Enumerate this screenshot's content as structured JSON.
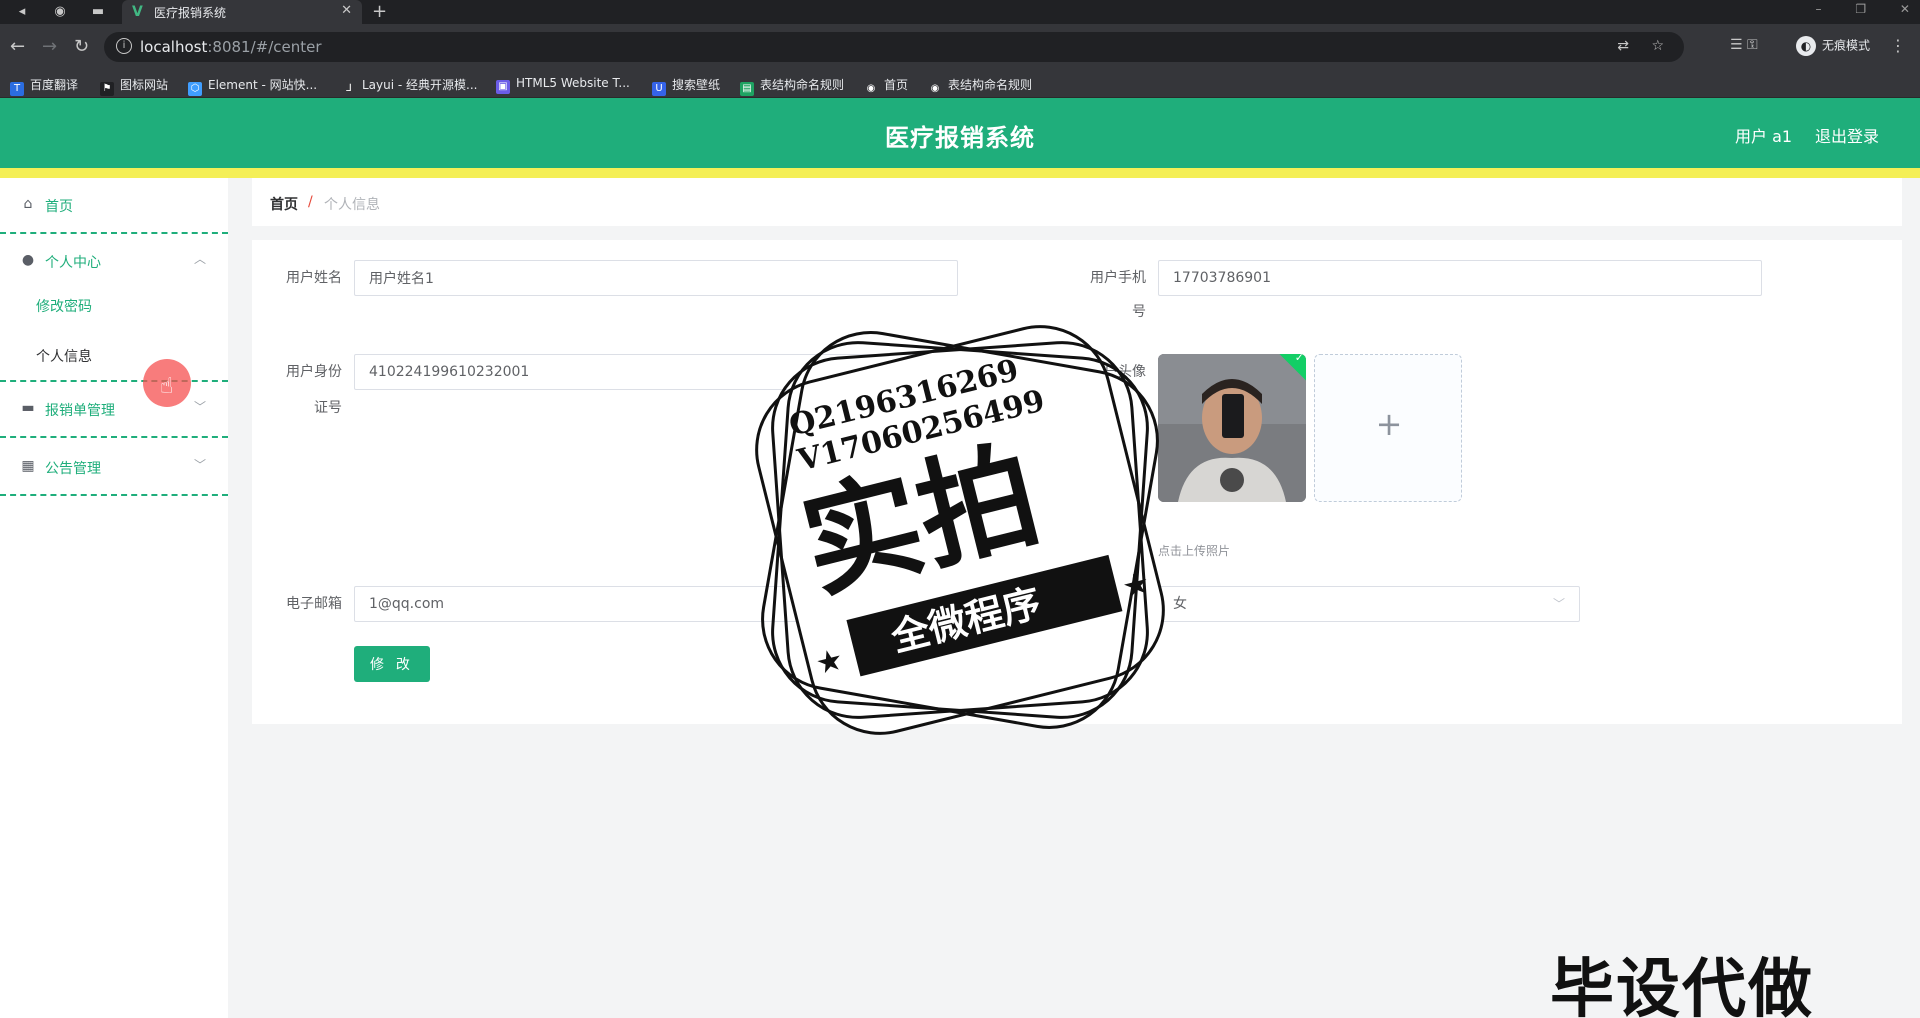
{
  "browser": {
    "tab_title": "医疗报销系统",
    "url_host": "localhost",
    "url_rest": ":8081/#/center",
    "mode_label": "无痕模式",
    "bookmarks": [
      "百度翻译",
      "图标网站",
      "Element - 网站快...",
      "Layui - 经典开源模...",
      "HTML5 Website T...",
      "搜索壁纸",
      "表结构命名规则",
      "首页",
      "表结构命名规则"
    ]
  },
  "header": {
    "title": "医疗报销系统",
    "user": "用户 a1",
    "logout": "退出登录"
  },
  "sidebar": {
    "home": "首页",
    "personal_center": "个人中心",
    "change_password": "修改密码",
    "personal_info": "个人信息",
    "reimbursement": "报销单管理",
    "notice": "公告管理"
  },
  "breadcrumb": {
    "home": "首页",
    "separator": "/",
    "current": "个人信息"
  },
  "form": {
    "name_label": "用户姓名",
    "name_value": "用户姓名1",
    "phone_label_1": "用户手机",
    "phone_label_2": "号",
    "phone_value": "17703786901",
    "idcard_label_1": "用户身份",
    "idcard_label_2": "证号",
    "idcard_value": "410224199610232001",
    "avatar_label": "用户头像",
    "upload_tip": "点击上传照片",
    "email_label": "电子邮箱",
    "email_value": "1@qq.com",
    "gender_value": "女",
    "submit": "修 改"
  },
  "watermark": {
    "line1": "Q2196316269",
    "line2": "V17060256499",
    "big": "实拍",
    "ribbon": "全微程序",
    "corner": "毕设代做"
  }
}
